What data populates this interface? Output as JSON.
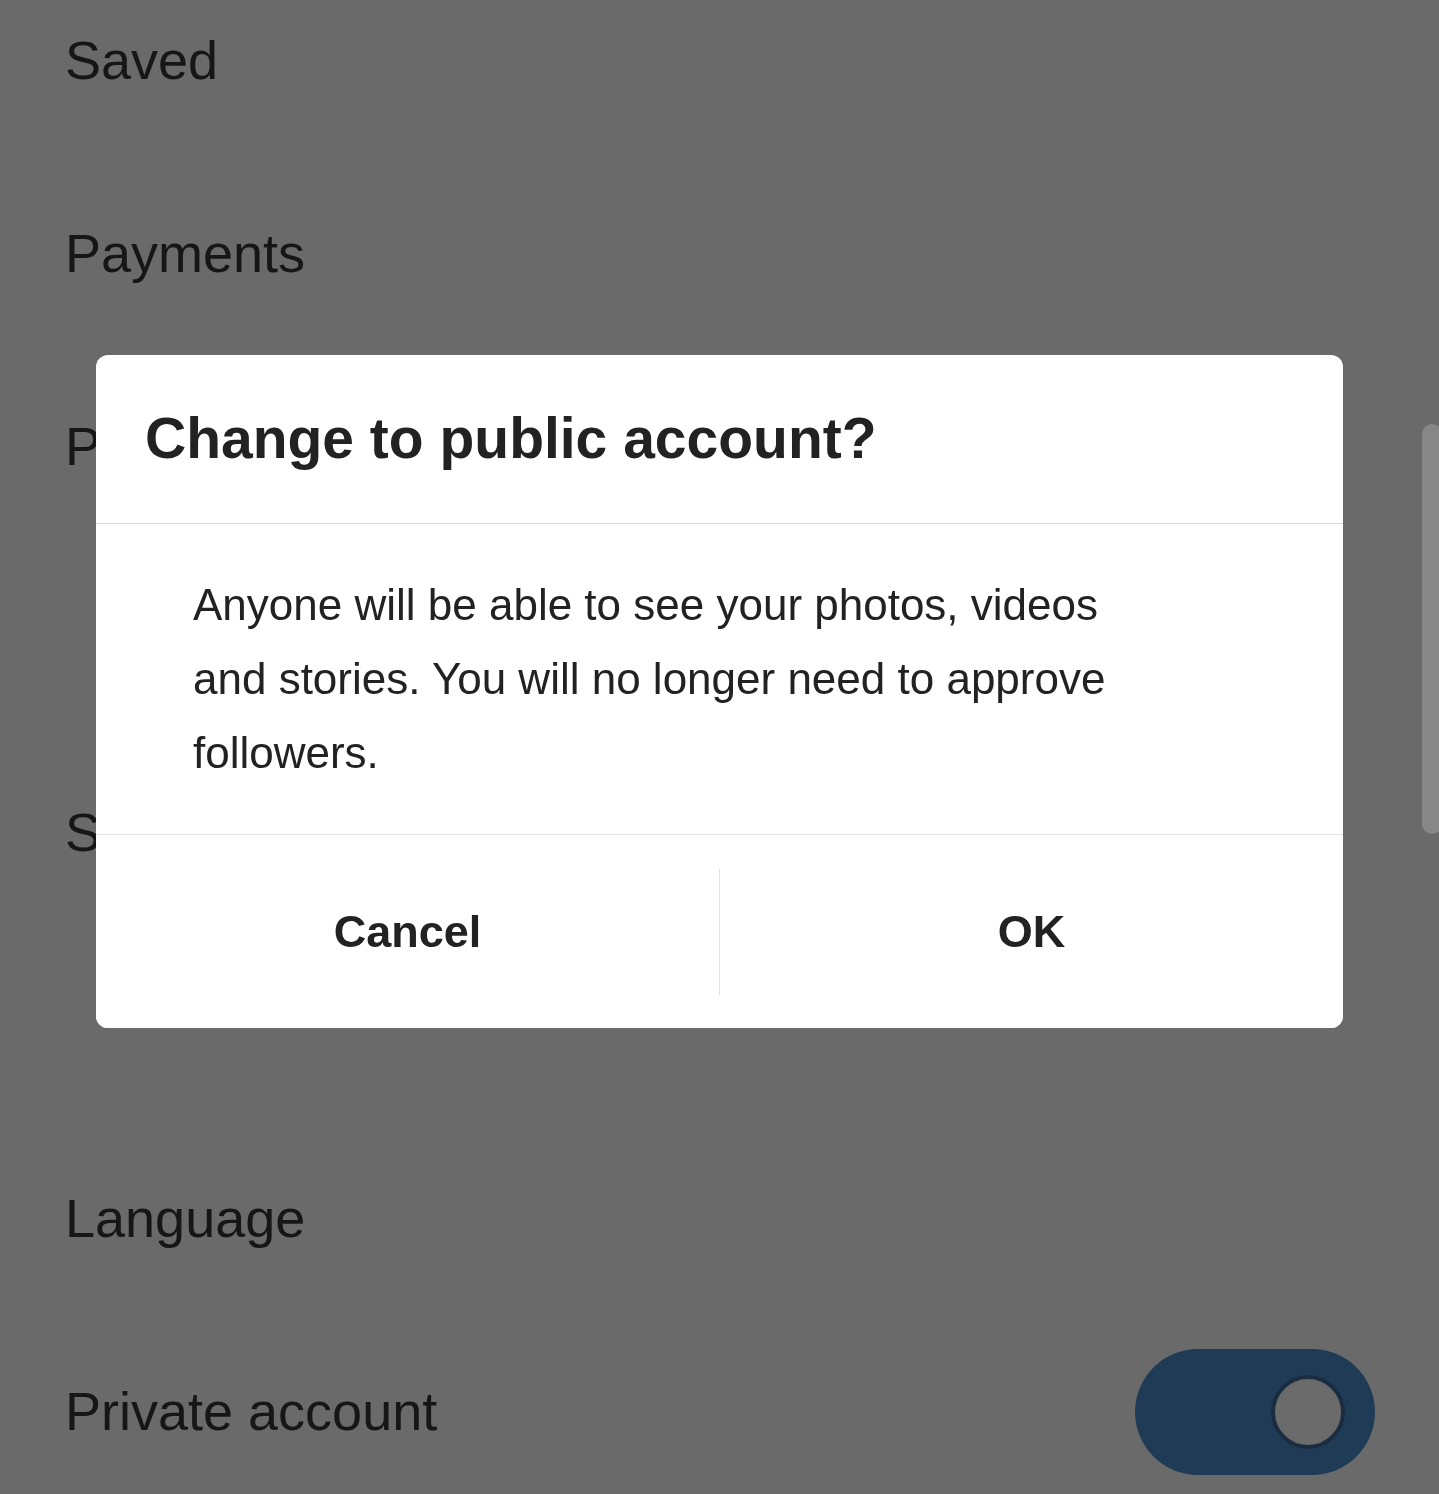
{
  "settings_items": [
    {
      "label": "Saved",
      "kind": "text"
    },
    {
      "label": "Payments",
      "kind": "text"
    },
    {
      "label": "P",
      "kind": "text"
    },
    {
      "kind": "covered"
    },
    {
      "label": "S",
      "kind": "text"
    },
    {
      "kind": "covered"
    },
    {
      "label": "Language",
      "kind": "text"
    },
    {
      "label": "Private account",
      "kind": "toggle",
      "on": true
    }
  ],
  "dialog": {
    "title": "Change to public account?",
    "message": "Anyone will be able to see your photos, videos and stories. You will no longer need to approve followers.",
    "buttons": [
      "Cancel",
      "OK"
    ]
  }
}
